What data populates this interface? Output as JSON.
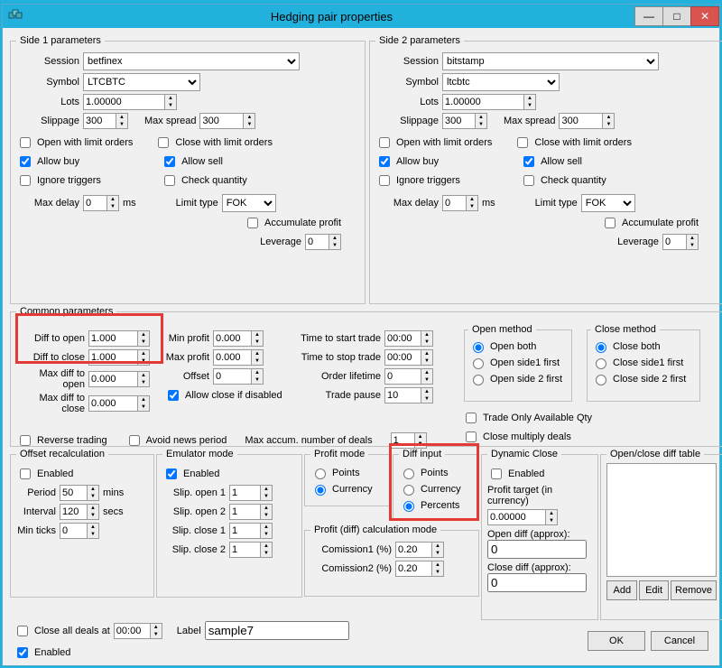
{
  "window": {
    "title": "Hedging pair properties"
  },
  "side1": {
    "legend": "Side 1 parameters",
    "session_label": "Session",
    "session": "betfinex",
    "symbol_label": "Symbol",
    "symbol": "LTCBTC",
    "lots_label": "Lots",
    "lots": "1.00000",
    "slippage_label": "Slippage",
    "slippage": "300",
    "maxspread_label": "Max spread",
    "maxspread": "300",
    "open_limit": "Open with limit orders",
    "close_limit": "Close with limit orders",
    "allow_buy": "Allow buy",
    "allow_sell": "Allow sell",
    "ignore_triggers": "Ignore triggers",
    "check_qty": "Check quantity",
    "maxdelay_label": "Max delay",
    "maxdelay": "0",
    "ms": "ms",
    "limittype_label": "Limit type",
    "limittype": "FOK",
    "accum_profit": "Accumulate profit",
    "leverage_label": "Leverage",
    "leverage": "0"
  },
  "side2": {
    "legend": "Side 2 parameters",
    "session_label": "Session",
    "session": "bitstamp",
    "symbol_label": "Symbol",
    "symbol": "ltcbtc",
    "lots_label": "Lots",
    "lots": "1.00000",
    "slippage_label": "Slippage",
    "slippage": "300",
    "maxspread_label": "Max spread",
    "maxspread": "300",
    "open_limit": "Open with limit orders",
    "close_limit": "Close with limit orders",
    "allow_buy": "Allow buy",
    "allow_sell": "Allow sell",
    "ignore_triggers": "Ignore triggers",
    "check_qty": "Check quantity",
    "maxdelay_label": "Max delay",
    "maxdelay": "0",
    "ms": "ms",
    "limittype_label": "Limit type",
    "limittype": "FOK",
    "accum_profit": "Accumulate profit",
    "leverage_label": "Leverage",
    "leverage": "0"
  },
  "common": {
    "legend": "Common parameters",
    "diff_open_label": "Diff to open",
    "diff_open": "1.000",
    "diff_close_label": "Diff to close",
    "diff_close": "1.000",
    "max_diff_open_label": "Max diff to open",
    "max_diff_open": "0.000",
    "max_diff_close_label": "Max diff to close",
    "max_diff_close": "0.000",
    "min_profit_label": "Min profit",
    "min_profit": "0.000",
    "max_profit_label": "Max profit",
    "max_profit": "0.000",
    "offset_label": "Offset",
    "offset": "0",
    "allow_close_disabled": "Allow close if disabled",
    "time_start_label": "Time to start trade",
    "time_start": "00:00",
    "time_stop_label": "Time to stop trade",
    "time_stop": "00:00",
    "order_lifetime_label": "Order lifetime",
    "order_lifetime": "0",
    "trade_pause_label": "Trade pause",
    "trade_pause": "10",
    "reverse_trading": "Reverse trading",
    "avoid_news": "Avoid news period",
    "max_accum_label": "Max accum. number of deals",
    "max_accum": "1",
    "open_method": "Open method",
    "open_both": "Open both",
    "open_side1": "Open side1 first",
    "open_side2": "Open side 2 first",
    "close_method": "Close method",
    "close_both": "Close both",
    "close_side1": "Close side1 first",
    "close_side2": "Close side 2 first",
    "trade_only_qty": "Trade Only Available Qty",
    "close_multiply": "Close multiply deals"
  },
  "offsetrec": {
    "legend": "Offset recalculation",
    "enabled": "Enabled",
    "period_label": "Period",
    "period": "50",
    "mins": "mins",
    "interval_label": "Interval",
    "interval": "120",
    "secs": "secs",
    "min_ticks_label": "Min ticks",
    "min_ticks": "0"
  },
  "emulator": {
    "legend": "Emulator mode",
    "enabled": "Enabled",
    "slip_open1_label": "Slip. open 1",
    "slip_open1": "1",
    "slip_open2_label": "Slip. open 2",
    "slip_open2": "1",
    "slip_close1_label": "Slip. close 1",
    "slip_close1": "1",
    "slip_close2_label": "Slip. close 2",
    "slip_close2": "1"
  },
  "profitmode": {
    "legend": "Profit mode",
    "points": "Points",
    "currency": "Currency"
  },
  "diffinput": {
    "legend": "Diff input",
    "points": "Points",
    "currency": "Currency",
    "percents": "Percents"
  },
  "profitcalc": {
    "legend": "Profit (diff) calculation mode",
    "com1_label": "Comission1 (%)",
    "com1": "0.20",
    "com2_label": "Comission2 (%)",
    "com2": "0.20"
  },
  "dynclose": {
    "legend": "Dynamic Close",
    "enabled": "Enabled",
    "profit_target_label": "Profit target (in currency)",
    "profit_target": "0.00000",
    "open_diff_label": "Open diff (approx):",
    "open_diff": "0",
    "close_diff_label": "Close diff (approx):",
    "close_diff": "0"
  },
  "octable": {
    "legend": "Open/close diff table",
    "add": "Add",
    "edit": "Edit",
    "remove": "Remove"
  },
  "bottom": {
    "close_all_label": "Close all deals at",
    "close_all": "00:00",
    "label_label": "Label",
    "label": "sample7",
    "enabled": "Enabled",
    "ok": "OK",
    "cancel": "Cancel"
  }
}
